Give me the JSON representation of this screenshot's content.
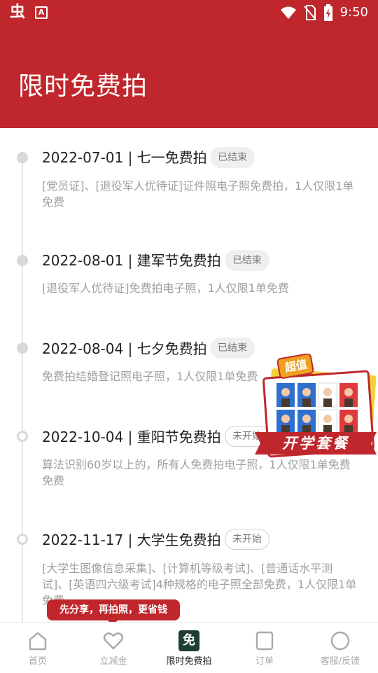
{
  "status_bar": {
    "app_icon": "虫",
    "a_icon": "A",
    "time": "9:50"
  },
  "header": {
    "title": "限时免费拍"
  },
  "events": [
    {
      "date_title": "2022-07-01 | 七一免费拍",
      "status": "已结束",
      "desc": "[党员证]、[退役军人优待证]证件照电子照免费拍，1人仅限1单免费"
    },
    {
      "date_title": "2022-08-01 | 建军节免费拍",
      "status": "已结束",
      "desc": "[退役军人优待证]免费拍电子照，1人仅限1单免费"
    },
    {
      "date_title": "2022-08-04 | 七夕免费拍",
      "status": "已结束",
      "desc": "免费拍结婚登记照电子照，1人仅限1单免费"
    },
    {
      "date_title": "2022-10-04 | 重阳节免费拍",
      "status": "未开始",
      "desc": "算法识别60岁以上的，所有人免费拍电子照，1人仅限1单免费免费"
    },
    {
      "date_title": "2022-11-17 | 大学生免费拍",
      "status": "未开始",
      "desc": "[大学生图像信息采集]、[计算机等级考试]、[普通话水平测试]、[英语四六级考试]4种规格的电子照全部免费，1人仅限1单免费"
    }
  ],
  "promo": {
    "tag": "超值",
    "banner": "开学套餐"
  },
  "tooltip": {
    "text": "先分享，再拍照，更省钱"
  },
  "bottom_nav": {
    "items": [
      {
        "label": "首页",
        "icon": "home-icon"
      },
      {
        "label": "立减金",
        "icon": "heart-icon"
      },
      {
        "label": "限时免费拍",
        "icon": "free-badge-icon",
        "icon_text": "免"
      },
      {
        "label": "订单",
        "icon": "order-icon"
      },
      {
        "label": "客服/反馈",
        "icon": "service-icon"
      }
    ]
  },
  "colors": {
    "brand_red": "#c0272d",
    "active_nav_bg": "#1e3d35"
  }
}
